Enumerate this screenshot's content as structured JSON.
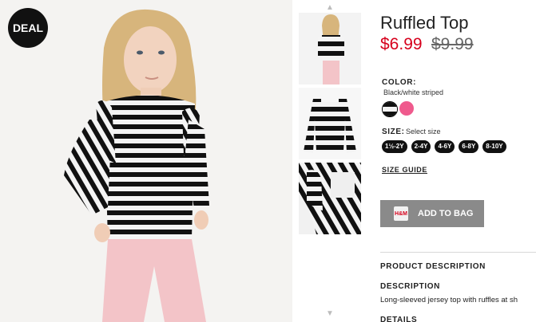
{
  "badge": {
    "label": "DEAL"
  },
  "product": {
    "title": "Ruffled Top",
    "price": "$6.99",
    "old_price": "$9.99",
    "color_label": "COLOR:",
    "color_value": "Black/white striped",
    "colors": [
      {
        "name": "black-white-striped",
        "hex": "#1a1a1a"
      },
      {
        "name": "pink",
        "hex": "#ef5a8d"
      }
    ],
    "size_label": "SIZE:",
    "size_hint": "Select size",
    "sizes": [
      "1½-2Y",
      "2-4Y",
      "4-6Y",
      "6-8Y",
      "8-10Y"
    ],
    "size_guide": "SIZE GUIDE",
    "add_to_bag": "ADD TO BAG",
    "bag_brand": "H&M"
  },
  "sections": {
    "product_description": "PRODUCT DESCRIPTION",
    "description_label": "DESCRIPTION",
    "description_text": "Long-sleeved jersey top with ruffles at sh",
    "details_label": "DETAILS"
  },
  "nav": {
    "up_icon": "chevron-up-icon",
    "down_icon": "chevron-down-icon"
  }
}
